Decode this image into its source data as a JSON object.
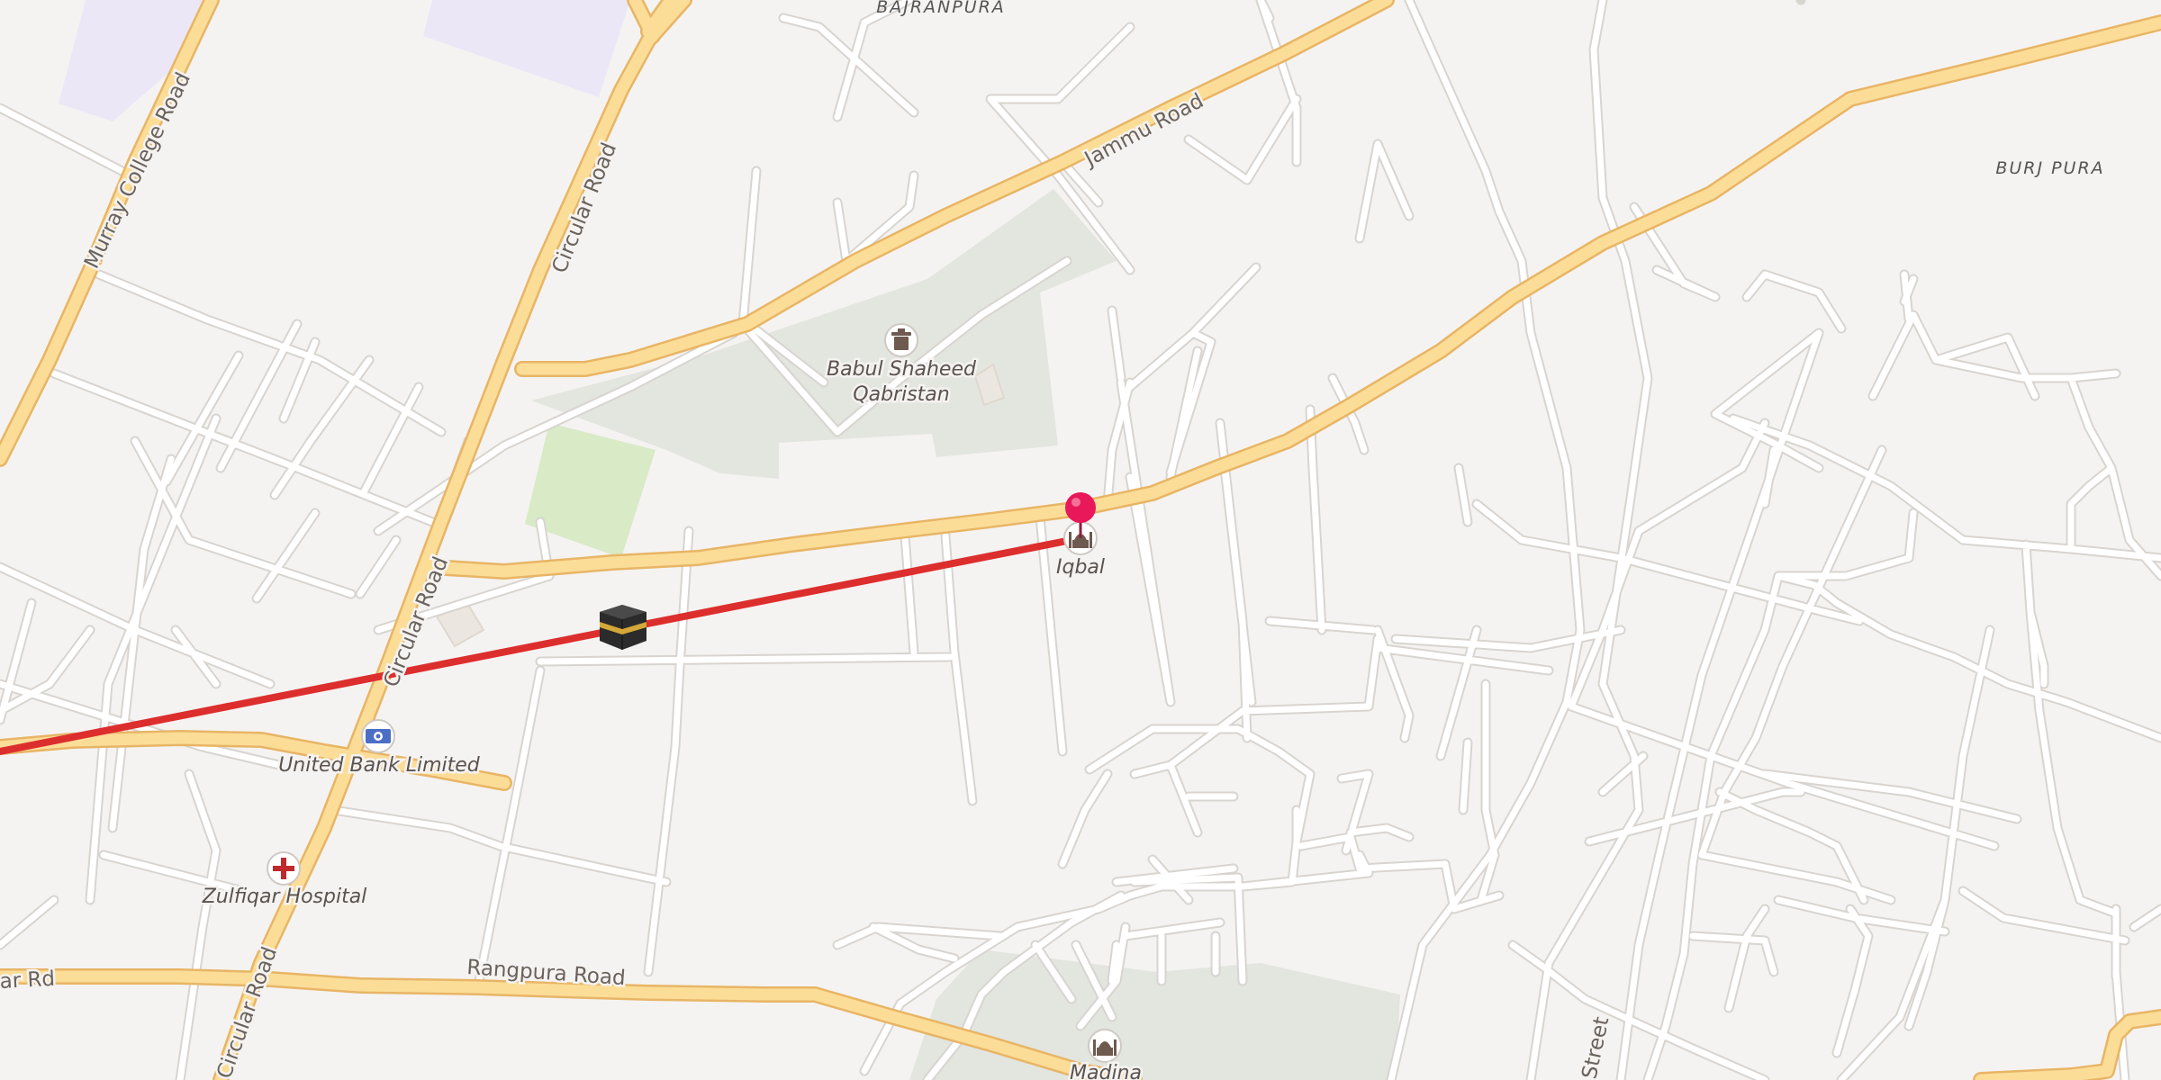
{
  "map": {
    "area_labels": {
      "bajranpura": "BAJRANPURA",
      "burj_pura": "BURJ PURA"
    },
    "road_labels": {
      "murray_college_road": "Murray College Road",
      "circular_road_top": "Circular Road",
      "circular_road_mid": "Circular Road",
      "circular_road_bottom": "Circular Road",
      "jammu_road": "Jammu Road",
      "rangpura_road": "Rangpura Road",
      "left_rd": "ar Rd",
      "street_bottom": "Street"
    },
    "pois": {
      "qabristan_line1": "Babul Shaheed",
      "qabristan_line2": "Qabristan",
      "iqbal": "Iqbal",
      "united_bank": "United Bank Limited",
      "zulfiqar_hospital": "Zulfiqar Hospital",
      "madina": "Madina"
    },
    "icons": {
      "cemetery": "cemetery-icon",
      "mosque": "mosque-icon",
      "bank": "bank-icon",
      "hospital": "hospital-icon",
      "kaaba": "kaaba-icon",
      "pin": "location-pin-icon"
    },
    "colors": {
      "route_line": "#dd2e2e",
      "pin": "#e8185a",
      "major_road": "#fbdd97",
      "park_green": "#d8eac6",
      "cemetery_area": "#e3e5df",
      "residential_purple": "#ece7f7",
      "hospital_cross": "#c0292b",
      "bank_blue": "#4b6fc4"
    }
  }
}
